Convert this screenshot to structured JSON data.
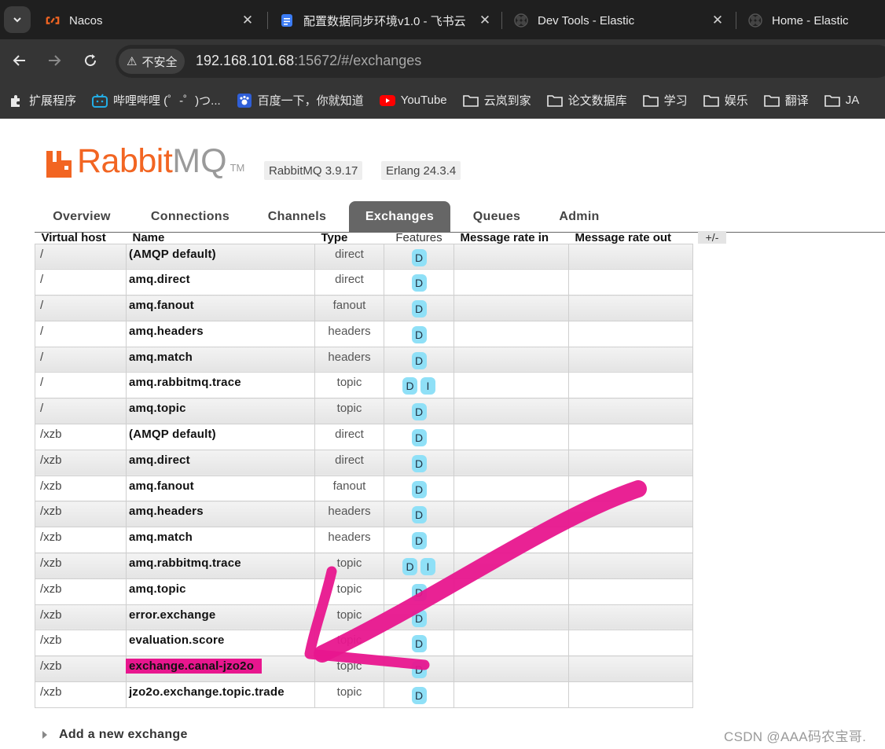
{
  "browser": {
    "tabs": [
      {
        "title": "Nacos",
        "icon": "nacos-icon"
      },
      {
        "title": "配置数据同步环境v1.0 - 飞书云",
        "icon": "feishu-doc-icon"
      },
      {
        "title": "Dev Tools - Elastic",
        "icon": "elastic-icon"
      },
      {
        "title": "Home - Elastic",
        "icon": "elastic-icon"
      }
    ],
    "tab_close_glyph": "✕",
    "security_label": "不安全",
    "url_host": "192.168.101.68",
    "url_rest": ":15672/#/exchanges",
    "bookmarks": [
      {
        "label": "扩展程序",
        "icon": "puzzle-icon"
      },
      {
        "label": "哔哩哔哩 (゜-゜)つ...",
        "icon": "bilibili-icon"
      },
      {
        "label": "百度一下，你就知道",
        "icon": "baidu-icon"
      },
      {
        "label": "YouTube",
        "icon": "youtube-icon"
      },
      {
        "label": "云岚到家",
        "icon": "folder-icon"
      },
      {
        "label": "论文数据库",
        "icon": "folder-icon"
      },
      {
        "label": "学习",
        "icon": "folder-icon"
      },
      {
        "label": "娱乐",
        "icon": "folder-icon"
      },
      {
        "label": "翻译",
        "icon": "folder-icon"
      },
      {
        "label": "JA",
        "icon": "folder-icon"
      }
    ]
  },
  "app": {
    "logo_word1": "Rabbit",
    "logo_word2": "MQ",
    "logo_tm": "TM",
    "version": "RabbitMQ 3.9.17",
    "erlang": "Erlang 24.3.4",
    "brand_color": "#f26522"
  },
  "nav_tabs": [
    "Overview",
    "Connections",
    "Channels",
    "Exchanges",
    "Queues",
    "Admin"
  ],
  "active_tab": "Exchanges",
  "table": {
    "headers": {
      "vhost": "Virtual host",
      "name": "Name",
      "type": "Type",
      "features": "Features",
      "rate_in": "Message rate in",
      "rate_out": "Message rate out"
    },
    "plus_minus": "+/-",
    "rows": [
      {
        "vhost": "/",
        "name": "(AMQP default)",
        "type": "direct",
        "features": [
          "D"
        ]
      },
      {
        "vhost": "/",
        "name": "amq.direct",
        "type": "direct",
        "features": [
          "D"
        ]
      },
      {
        "vhost": "/",
        "name": "amq.fanout",
        "type": "fanout",
        "features": [
          "D"
        ]
      },
      {
        "vhost": "/",
        "name": "amq.headers",
        "type": "headers",
        "features": [
          "D"
        ]
      },
      {
        "vhost": "/",
        "name": "amq.match",
        "type": "headers",
        "features": [
          "D"
        ]
      },
      {
        "vhost": "/",
        "name": "amq.rabbitmq.trace",
        "type": "topic",
        "features": [
          "D",
          "I"
        ]
      },
      {
        "vhost": "/",
        "name": "amq.topic",
        "type": "topic",
        "features": [
          "D"
        ]
      },
      {
        "vhost": "/xzb",
        "name": "(AMQP default)",
        "type": "direct",
        "features": [
          "D"
        ]
      },
      {
        "vhost": "/xzb",
        "name": "amq.direct",
        "type": "direct",
        "features": [
          "D"
        ]
      },
      {
        "vhost": "/xzb",
        "name": "amq.fanout",
        "type": "fanout",
        "features": [
          "D"
        ]
      },
      {
        "vhost": "/xzb",
        "name": "amq.headers",
        "type": "headers",
        "features": [
          "D"
        ]
      },
      {
        "vhost": "/xzb",
        "name": "amq.match",
        "type": "headers",
        "features": [
          "D"
        ]
      },
      {
        "vhost": "/xzb",
        "name": "amq.rabbitmq.trace",
        "type": "topic",
        "features": [
          "D",
          "I"
        ]
      },
      {
        "vhost": "/xzb",
        "name": "amq.topic",
        "type": "topic",
        "features": [
          "D"
        ]
      },
      {
        "vhost": "/xzb",
        "name": "error.exchange",
        "type": "topic",
        "features": [
          "D"
        ]
      },
      {
        "vhost": "/xzb",
        "name": "evaluation.score",
        "type": "topic",
        "features": [
          "D"
        ]
      },
      {
        "vhost": "/xzb",
        "name": "exchange.canal-jzo2o",
        "type": "topic",
        "features": [
          "D"
        ],
        "highlighted": true
      },
      {
        "vhost": "/xzb",
        "name": "jzo2o.exchange.topic.trade",
        "type": "topic",
        "features": [
          "D"
        ]
      }
    ]
  },
  "add_exchange_label": "Add a new exchange",
  "watermark": "CSDN @AAA码农宝哥.",
  "annotation_color": "#e8168e"
}
